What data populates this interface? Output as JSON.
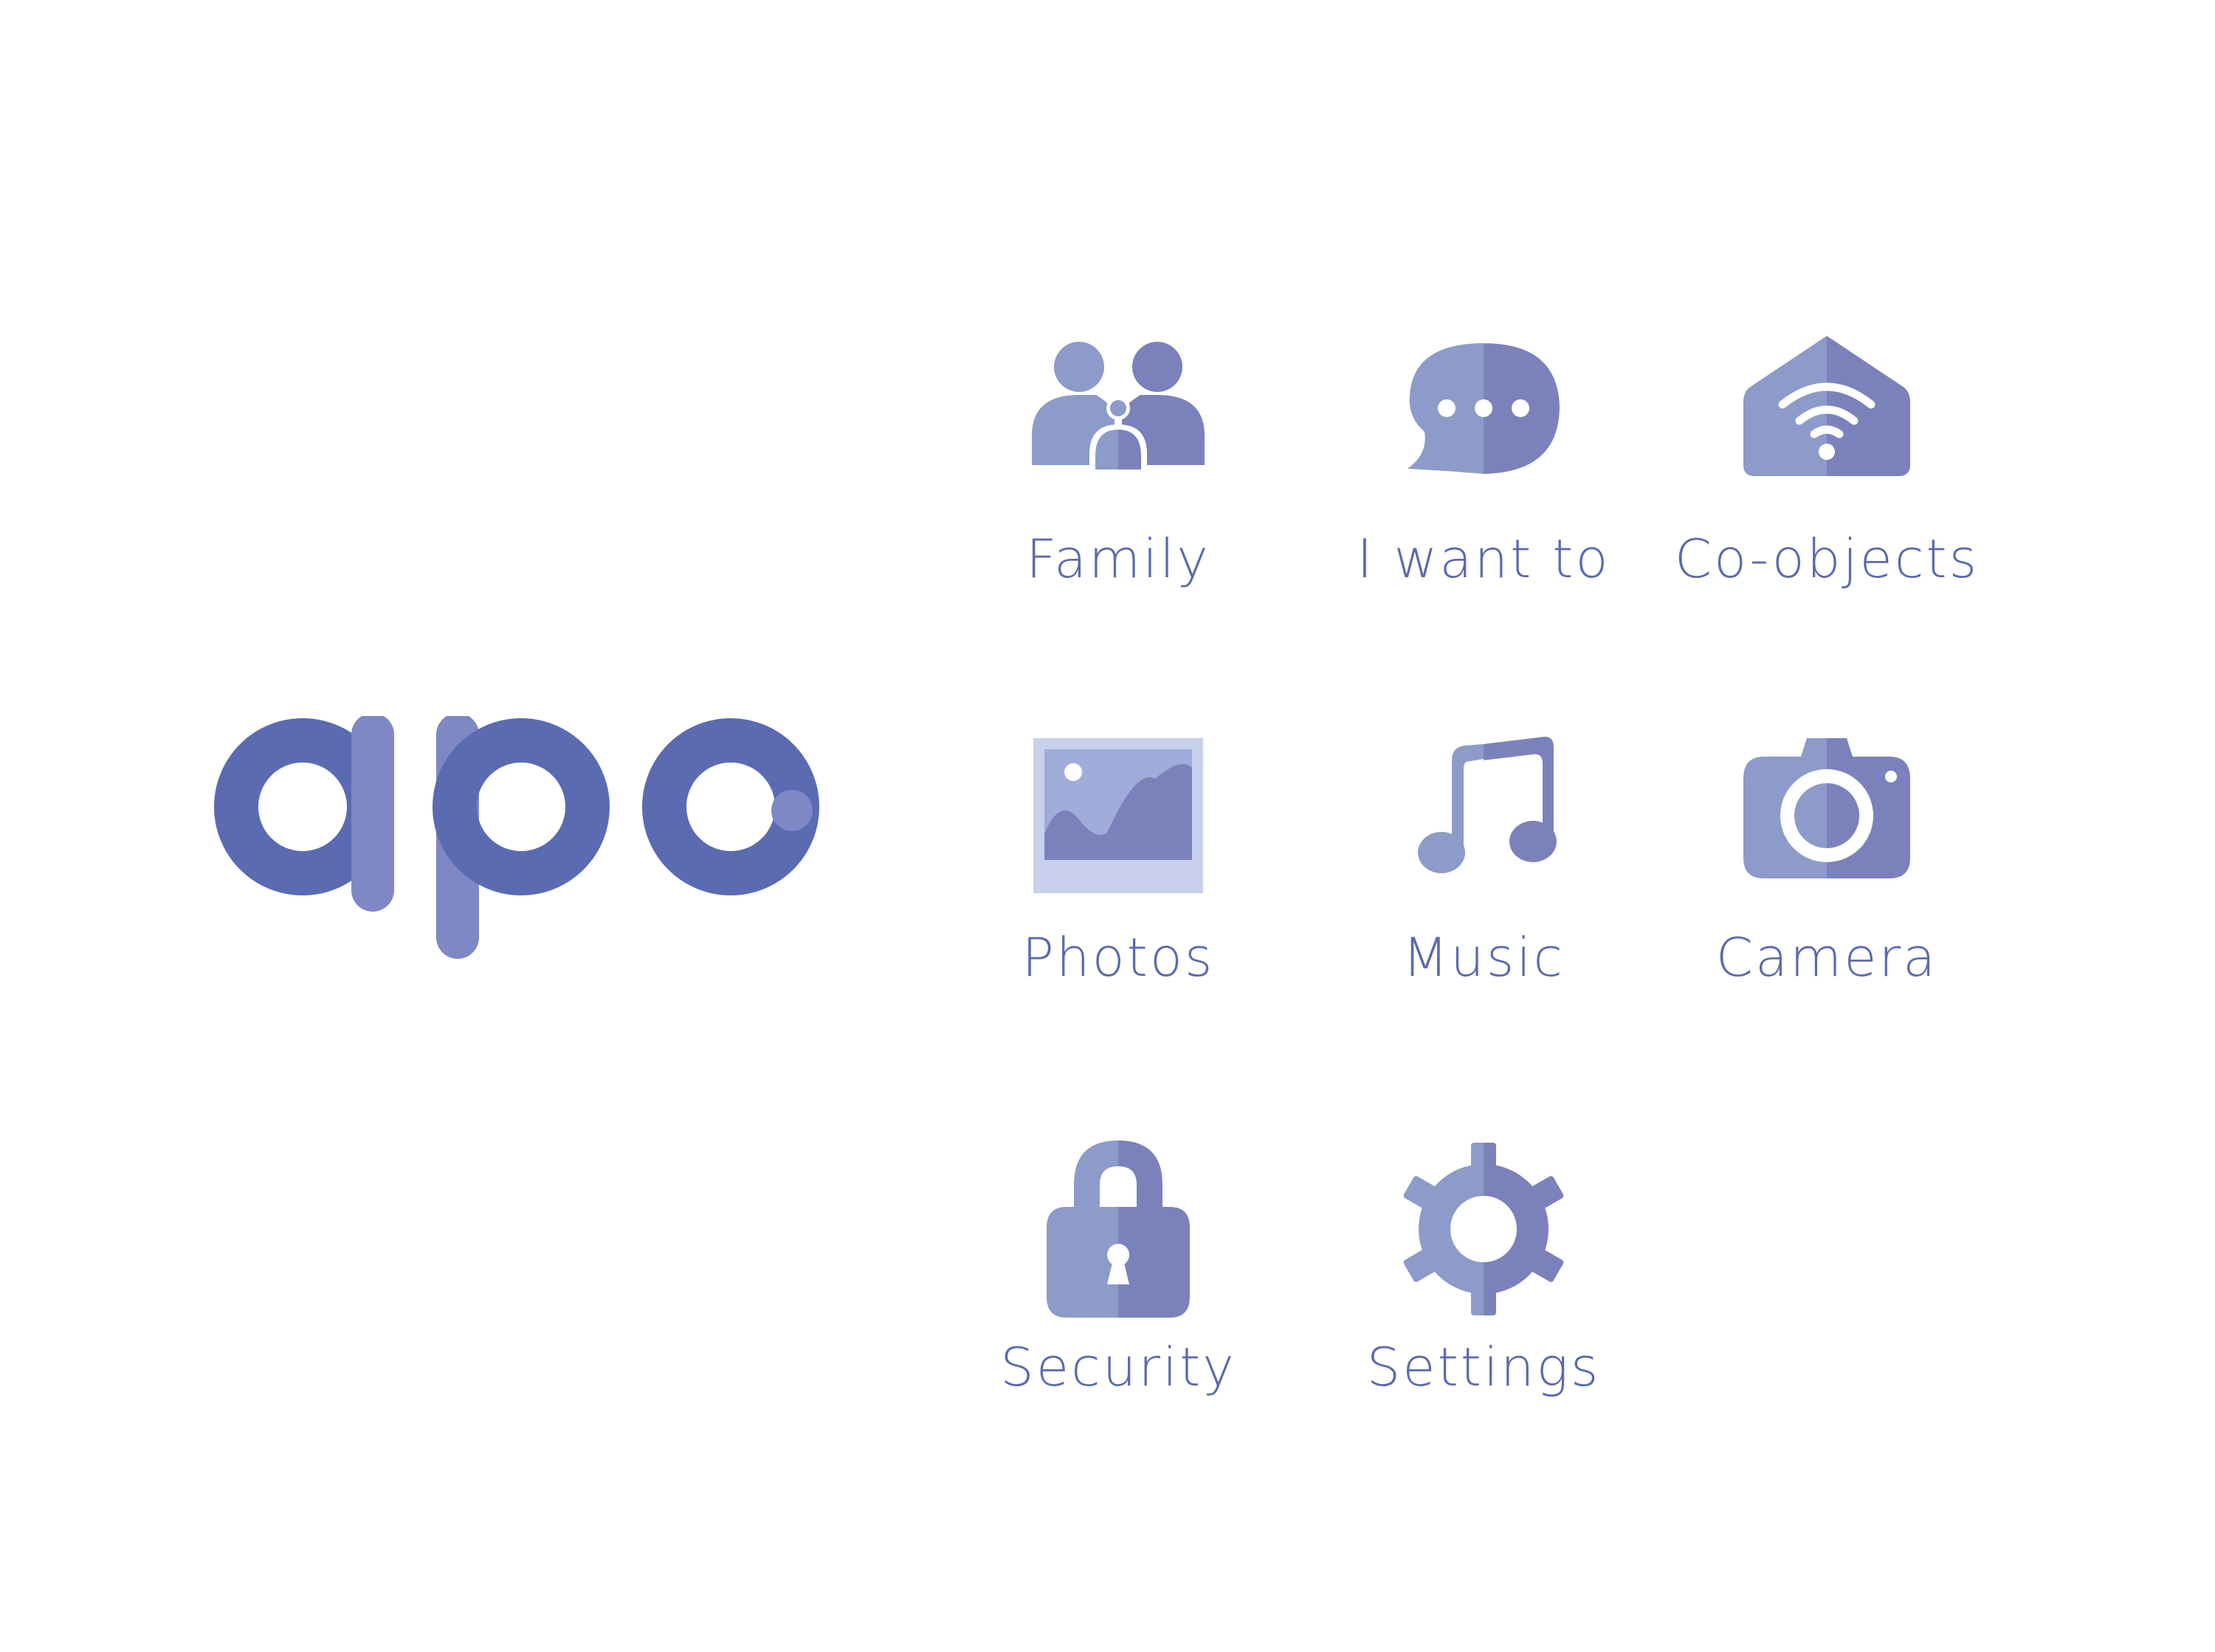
{
  "brand": {
    "name": "apo"
  },
  "apps": [
    {
      "id": "family",
      "label": "Family",
      "icon": "family-icon"
    },
    {
      "id": "i-want-to",
      "label": "I want to",
      "icon": "speech-bubble-icon"
    },
    {
      "id": "co-objects",
      "label": "Co-objects",
      "icon": "wifi-house-icon"
    },
    {
      "id": "photos",
      "label": "Photos",
      "icon": "image-icon"
    },
    {
      "id": "music",
      "label": "Music",
      "icon": "music-note-icon"
    },
    {
      "id": "camera",
      "label": "Camera",
      "icon": "camera-icon"
    },
    {
      "id": "security",
      "label": "Security",
      "icon": "padlock-icon"
    },
    {
      "id": "settings",
      "label": "Settings",
      "icon": "gear-icon"
    }
  ],
  "colors": {
    "brand": "#5b6bb2",
    "brand_light": "#7e88c4",
    "icon_light": "#8c9bc9",
    "icon_dark": "#7b82bb",
    "label": "#5b6aae",
    "background": "#ffffff"
  }
}
